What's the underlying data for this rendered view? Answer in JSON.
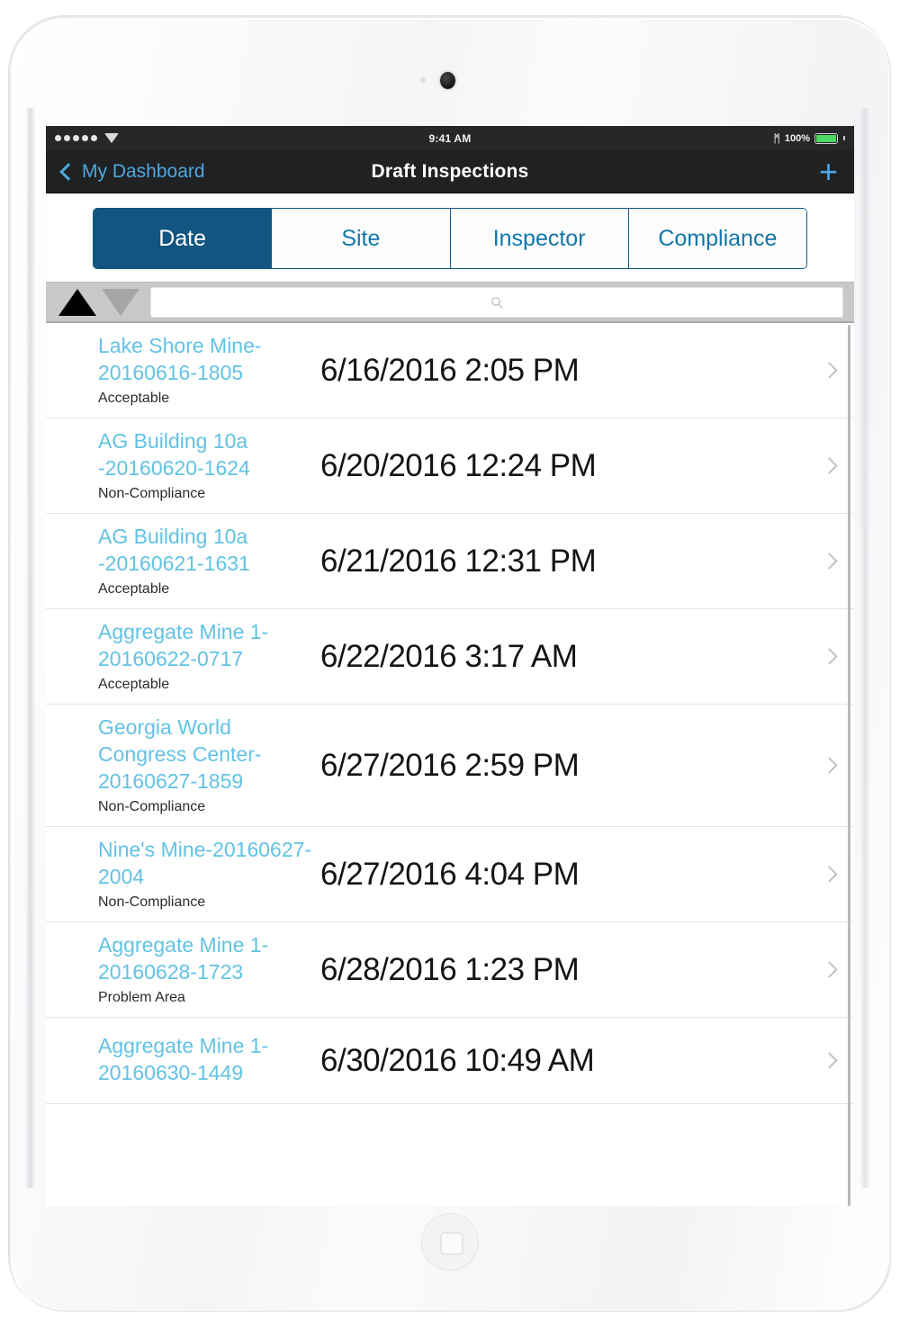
{
  "status_bar": {
    "signal_dots": 5,
    "wifi_icon": "wifi-icon",
    "time": "9:41 AM",
    "bluetooth_icon": "bluetooth-icon",
    "bluetooth_glyph": "ᛗ",
    "battery_percent": "100%",
    "battery_color": "#4cd964"
  },
  "nav_bar": {
    "back_label": "My Dashboard",
    "back_icon": "chevron-left-icon",
    "title": "Draft Inspections",
    "add_icon": "plus-icon",
    "add_glyph": "+",
    "accent_color": "#4fa8e0",
    "background": "#1f2123"
  },
  "tabs": {
    "selected_index": 0,
    "selected_color": "#115580",
    "items": [
      {
        "label": "Date"
      },
      {
        "label": "Site"
      },
      {
        "label": "Inspector"
      },
      {
        "label": "Compliance"
      }
    ]
  },
  "toolbar": {
    "sort_asc_icon": "sort-ascending-triangle-icon",
    "sort_desc_icon": "sort-descending-triangle-icon",
    "sort_direction": "ascending",
    "search_icon": "search-icon",
    "search_value": "",
    "search_placeholder": ""
  },
  "list": {
    "chevron_icon": "chevron-right-icon",
    "rows": [
      {
        "title": "Lake Shore Mine-20160616-1805",
        "status": "Acceptable",
        "date": "6/16/2016 2:05 PM"
      },
      {
        "title": "AG Building 10a -20160620-1624",
        "status": "Non-Compliance",
        "date": "6/20/2016 12:24 PM"
      },
      {
        "title": "AG Building 10a -20160621-1631",
        "status": "Acceptable",
        "date": "6/21/2016 12:31 PM"
      },
      {
        "title": "Aggregate Mine 1-20160622-0717",
        "status": "Acceptable",
        "date": "6/22/2016 3:17 AM"
      },
      {
        "title": "Georgia World Congress Center-20160627-1859",
        "status": "Non-Compliance",
        "date": "6/27/2016 2:59 PM"
      },
      {
        "title": "Nine's Mine-20160627-2004",
        "status": "Non-Compliance",
        "date": "6/27/2016 4:04 PM"
      },
      {
        "title": "Aggregate Mine 1-20160628-1723",
        "status": "Problem Area",
        "date": "6/28/2016 1:23 PM"
      },
      {
        "title": "Aggregate Mine 1-20160630-1449",
        "status": "",
        "date": "6/30/2016 10:49 AM"
      }
    ]
  },
  "device": {
    "camera_icon": "camera-icon",
    "sensor_icon": "proximity-sensor-icon",
    "home_button_icon": "home-button-icon"
  }
}
